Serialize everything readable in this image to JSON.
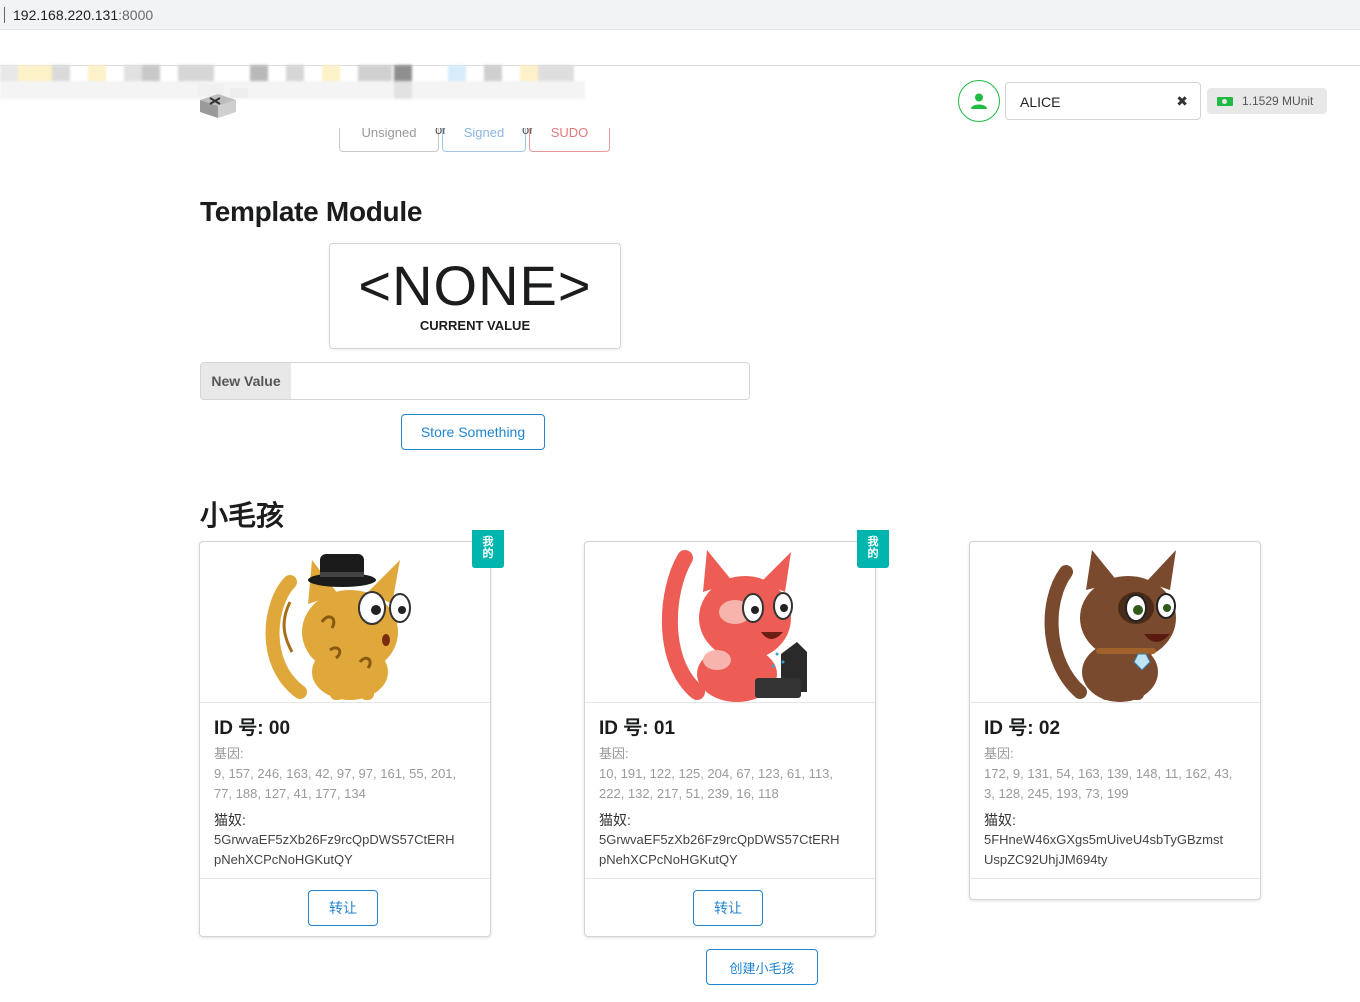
{
  "browser": {
    "url_host": "192.168.220.131",
    "url_port": ":8000"
  },
  "header": {
    "tabs": {
      "unsigned": "Unsigned",
      "or1": "or",
      "signed": "Signed",
      "or2": "or",
      "sudo": "SUDO"
    },
    "account": {
      "name": "ALICE",
      "clear_icon": "✖",
      "balance": "1.1529 MUnit"
    }
  },
  "template_module": {
    "title": "Template Module",
    "current_value": "<NONE>",
    "current_value_label": "CURRENT VALUE",
    "new_value_label": "New Value",
    "new_value_input": "",
    "store_button": "Store Something"
  },
  "kitties": {
    "title": "小毛孩",
    "id_label": "ID 号:",
    "genes_label": "基因:",
    "owner_label": "猫奴:",
    "mine_ribbon": [
      "我",
      "的"
    ],
    "transfer_button": "转让",
    "create_button": "创建小毛孩",
    "items": [
      {
        "id": "00",
        "genes_line1": "9, 157, 246, 163, 42, 97, 97, 161, 55, 201,",
        "genes_line2": "77, 188, 127, 41, 177, 134",
        "owner_line1": "5GrwvaEF5zXb26Fz9rcQpDWS57CtERH",
        "owner_line2": "pNehXCPcNoHGKutQY",
        "mine": true,
        "color": "#e0a83a"
      },
      {
        "id": "01",
        "genes_line1": "10, 191, 122, 125, 204, 67, 123, 61, 113,",
        "genes_line2": "222, 132, 217, 51, 239, 16, 118",
        "owner_line1": "5GrwvaEF5zXb26Fz9rcQpDWS57CtERH",
        "owner_line2": "pNehXCPcNoHGKutQY",
        "mine": true,
        "color": "#ee5d55"
      },
      {
        "id": "02",
        "genes_line1": "172, 9, 131, 54, 163, 139, 148, 11, 162, 43,",
        "genes_line2": "3, 128, 245, 193, 73, 199",
        "owner_line1": "5FHneW46xGXgs5mUiveU4sbTyGBzmst",
        "owner_line2": "UspZC92UhjJM694ty",
        "mine": false,
        "color": "#7a4a2f"
      }
    ]
  },
  "colors": {
    "primary": "#2185d0",
    "teal": "#00b5ad",
    "green": "#21ba45"
  }
}
